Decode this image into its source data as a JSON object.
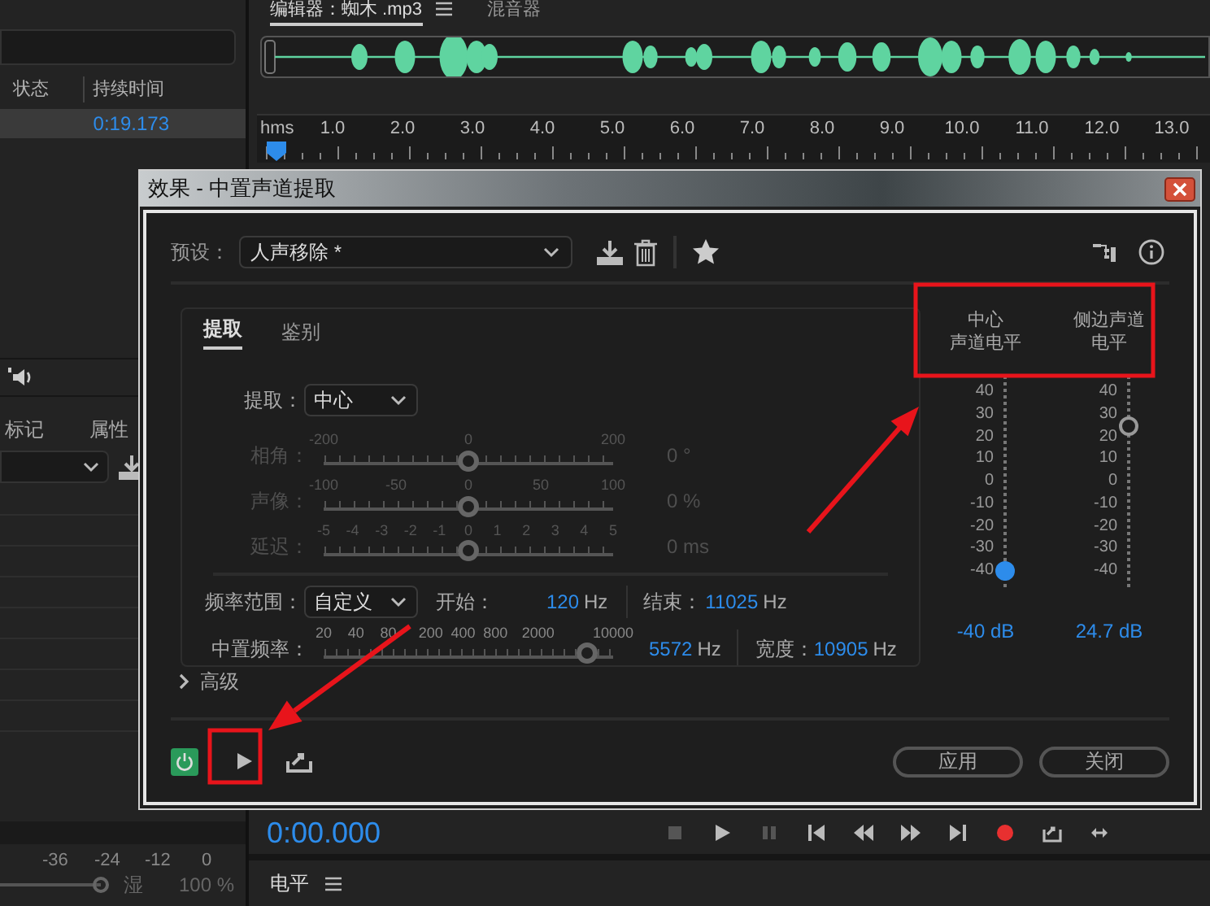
{
  "left_panel": {
    "columns": [
      "状态",
      "持续时间"
    ],
    "rows": [
      {
        "duration": "0:19.173",
        "selected": true
      }
    ],
    "panel_tabs": [
      "标记",
      "属性"
    ],
    "meter_ticks": [
      "-36",
      "-24",
      "-12",
      "0"
    ],
    "mix": {
      "label": "湿",
      "level": 1,
      "value": "100 %"
    }
  },
  "editor": {
    "tabs": [
      {
        "label": "编辑器：蜘木 .mp3",
        "selected": true
      },
      {
        "label": "混音器",
        "selected": false
      }
    ],
    "ruler_unit": "hms",
    "ruler_ticks": [
      "1.0",
      "2.0",
      "3.0",
      "4.0",
      "5.0",
      "6.0",
      "7.0",
      "8.0",
      "9.0",
      "10.0",
      "11.0",
      "12.0",
      "13.0"
    ],
    "time": "0:00.000"
  },
  "levels_panel": {
    "title": "电平"
  },
  "dialog": {
    "title": "效果 - 中置声道提取",
    "preset": {
      "label": "预设：",
      "value": "人声移除 *"
    },
    "tabs": [
      {
        "label": "提取",
        "selected": true
      },
      {
        "label": "鉴别",
        "selected": false
      }
    ],
    "extract": {
      "label": "提取：",
      "value": "中心"
    },
    "sliders": [
      {
        "label": "相角：",
        "ticks": [
          "-200",
          "0",
          "200"
        ],
        "level": 0.5,
        "reading": "0 °",
        "disabled": true
      },
      {
        "label": "声像：",
        "ticks": [
          "-100",
          "-50",
          "0",
          "50",
          "100"
        ],
        "level": 0.5,
        "reading": "0 %",
        "disabled": true
      },
      {
        "label": "延迟：",
        "ticks": [
          "-5",
          "-4",
          "-3",
          "-2",
          "-1",
          "0",
          "1",
          "2",
          "3",
          "4",
          "5"
        ],
        "level": 0.5,
        "reading": "0 ms",
        "disabled": true
      }
    ],
    "frequency_range": {
      "label": "频率范围：",
      "value": "自定义",
      "start_label": "开始：",
      "start_value": "120",
      "start_unit": "Hz",
      "end_label": "结束：",
      "end_value": "11025",
      "end_unit": "Hz"
    },
    "center_frequency": {
      "label": "中置频率：",
      "ticks": [
        "20",
        "40",
        "80",
        "200",
        "400",
        "800",
        "2000",
        "10000"
      ],
      "level": 0.91,
      "value": "5572",
      "unit": "Hz",
      "width_label": "宽度：",
      "width_value": "10905",
      "width_unit": "Hz"
    },
    "advanced": {
      "label": "高级",
      "expanded": false
    },
    "meters": [
      {
        "title": [
          "中心",
          "声道电平"
        ],
        "scale": [
          "40",
          "30",
          "20",
          "10",
          "0",
          "-10",
          "-20",
          "-30",
          "-40"
        ],
        "level": 0,
        "reading": "-40 dB",
        "selected": true
      },
      {
        "title": [
          "侧边声道",
          "电平"
        ],
        "scale": [
          "40",
          "30",
          "20",
          "10",
          "0",
          "-10",
          "-20",
          "-30",
          "-40"
        ],
        "level": 0.81,
        "reading": "24.7 dB",
        "selected": false
      }
    ],
    "power_on": true,
    "buttons": [
      "应用",
      "关闭"
    ]
  }
}
